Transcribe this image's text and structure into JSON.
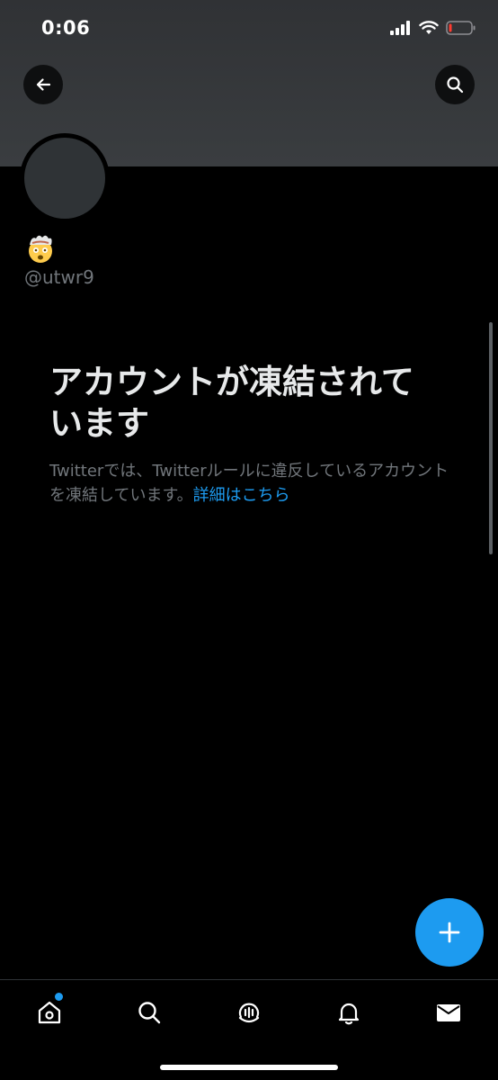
{
  "status_bar": {
    "time": "0:06",
    "icons": [
      "signal-icon",
      "wifi-icon",
      "battery-low-icon"
    ]
  },
  "header": {
    "back_icon": "arrow-left-icon",
    "search_icon": "search-icon"
  },
  "profile": {
    "emoji_name": "exploding-head-emoji",
    "handle": "@utwr9"
  },
  "suspended": {
    "title": "アカウントが凍結されています",
    "body": "Twitterでは、Twitterルールに違反しているアカウントを凍結しています。",
    "link": "詳細はこちら"
  },
  "fab": {
    "icon": "plus-icon"
  },
  "bottom_nav": {
    "items": [
      {
        "icon": "home-icon",
        "has_badge": true
      },
      {
        "icon": "search-icon"
      },
      {
        "icon": "spaces-icon"
      },
      {
        "icon": "bell-icon"
      },
      {
        "icon": "mail-icon"
      }
    ]
  },
  "colors": {
    "accent": "#1d9bf0",
    "background": "#000000",
    "banner": "#35383b",
    "muted_text": "#71767b"
  }
}
